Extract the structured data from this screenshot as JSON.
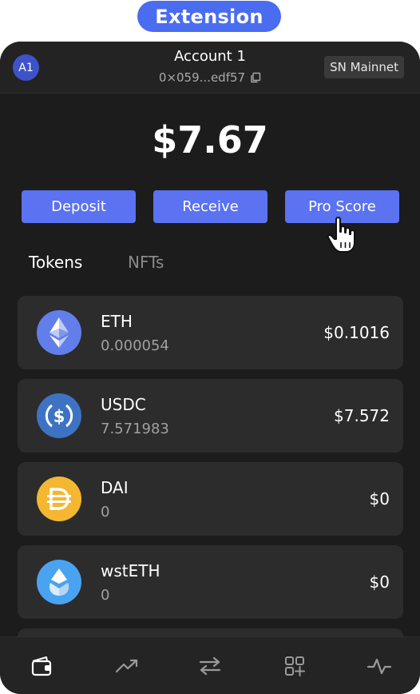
{
  "badge": {
    "label": "Extension"
  },
  "header": {
    "avatar": "A1",
    "account_name": "Account 1",
    "address": "0×059...edf57",
    "network": "SN Mainnet"
  },
  "balance": "$7.67",
  "actions": {
    "deposit": "Deposit",
    "receive": "Receive",
    "pro_score": "Pro Score"
  },
  "tabs": {
    "tokens": "Tokens",
    "nfts": "NFTs",
    "active": "Tokens"
  },
  "tokens": [
    {
      "symbol": "ETH",
      "amount": "0.000054",
      "value": "$0.1016",
      "icon": "ethereum-icon",
      "color": "#627eea"
    },
    {
      "symbol": "USDC",
      "amount": "7.571983",
      "value": "$7.572",
      "icon": "usdc-icon",
      "color": "#3e73c4"
    },
    {
      "symbol": "DAI",
      "amount": "0",
      "value": "$0",
      "icon": "dai-icon",
      "color": "#f4b731"
    },
    {
      "symbol": "wstETH",
      "amount": "0",
      "value": "$0",
      "icon": "wsteth-icon",
      "color": "#4aa3f0"
    }
  ],
  "bottom_nav": [
    "wallet-icon",
    "trending-icon",
    "swap-icon",
    "apps-icon",
    "activity-icon"
  ],
  "colors": {
    "accent": "#5b72f1",
    "background": "#1c1c1c",
    "card": "#2c2c2c"
  }
}
